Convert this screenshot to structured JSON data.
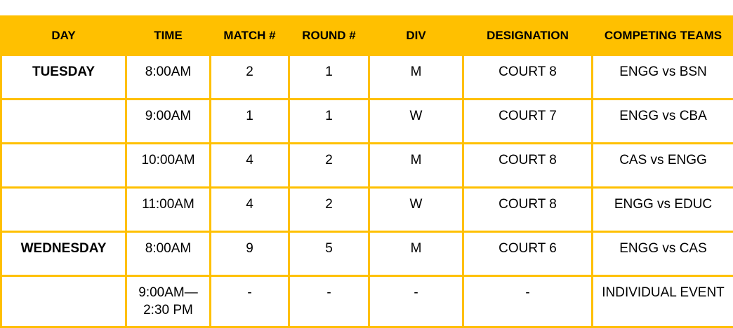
{
  "table": {
    "headers": [
      "DAY",
      "TIME",
      "MATCH #",
      "ROUND #",
      "DIV",
      "DESIGNATION",
      "COMPETING TEAMS"
    ],
    "rows": [
      {
        "day": "TUESDAY",
        "time": "8:00AM",
        "time2": "",
        "match": "2",
        "round": "1",
        "div": "M",
        "designation": "COURT 8",
        "teams": "ENGG vs BSN"
      },
      {
        "day": "",
        "time": "9:00AM",
        "time2": "",
        "match": "1",
        "round": "1",
        "div": "W",
        "designation": "COURT 7",
        "teams": "ENGG vs CBA"
      },
      {
        "day": "",
        "time": "10:00AM",
        "time2": "",
        "match": "4",
        "round": "2",
        "div": "M",
        "designation": "COURT 8",
        "teams": "CAS vs ENGG"
      },
      {
        "day": "",
        "time": "11:00AM",
        "time2": "",
        "match": "4",
        "round": "2",
        "div": "W",
        "designation": "COURT 8",
        "teams": "ENGG vs EDUC"
      },
      {
        "day": "WEDNESDAY",
        "time": "8:00AM",
        "time2": "",
        "match": "9",
        "round": "5",
        "div": "M",
        "designation": "COURT 6",
        "teams": "ENGG vs CAS"
      },
      {
        "day": "",
        "time": "9:00AM—",
        "time2": "2:30 PM",
        "match": "-",
        "round": "-",
        "div": "-",
        "designation": "-",
        "teams": "INDIVIDUAL EVENT"
      }
    ]
  },
  "colors": {
    "accent": "#FFC000",
    "background": "#FFFFFF",
    "text": "#000000"
  }
}
